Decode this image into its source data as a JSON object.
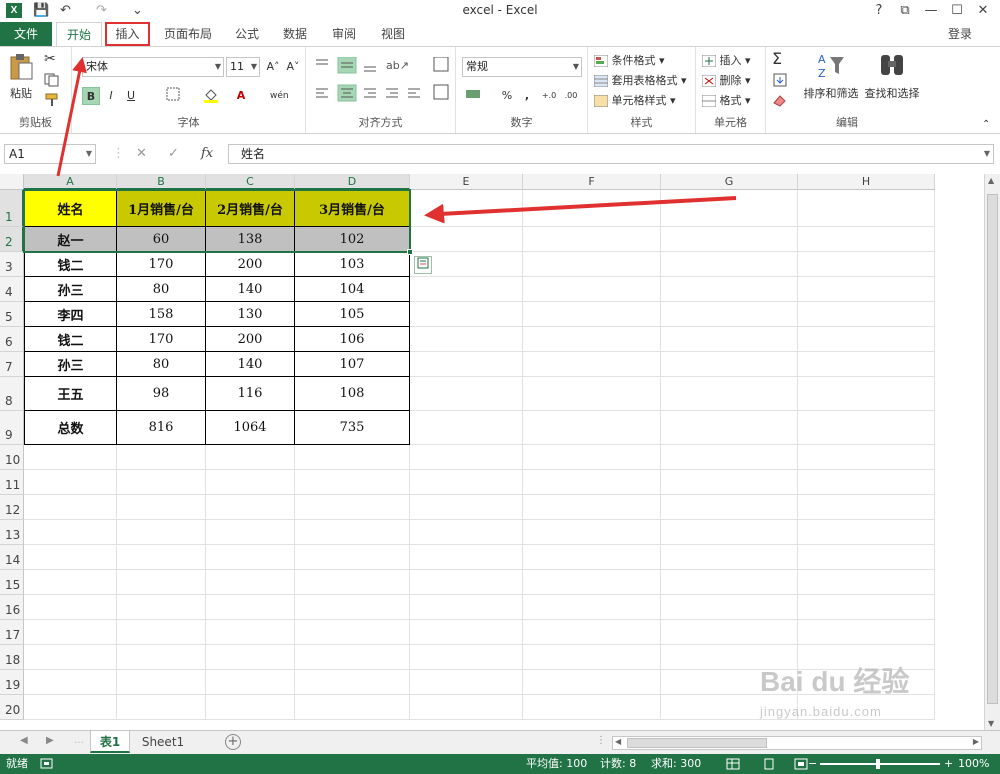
{
  "window": {
    "title": "excel - Excel",
    "help": "?",
    "restore": "⧉",
    "minimize": "—",
    "maximize": "☐",
    "close": "✕",
    "app_icon_label": "X"
  },
  "qat": {
    "save": "💾",
    "undo": "↶",
    "redo": "↷",
    "customize": "⌄"
  },
  "tabs": {
    "file": "文件",
    "items": [
      "开始",
      "插入",
      "页面布局",
      "公式",
      "数据",
      "审阅",
      "视图"
    ],
    "login": "登录"
  },
  "ribbon": {
    "clipboard": {
      "label": "剪贴板",
      "paste": "粘贴"
    },
    "font": {
      "label": "字体",
      "name": "宋体",
      "size": "11",
      "bold": "B",
      "italic": "I",
      "underline": "U",
      "grow": "A˄",
      "shrink": "A˅",
      "wen": "wén"
    },
    "alignment": {
      "label": "对齐方式"
    },
    "number": {
      "label": "数字",
      "format": "常规",
      "percent": "%",
      "comma": ",",
      "inc": "+.0",
      "dec": ".00"
    },
    "styles": {
      "label": "样式",
      "cond": "条件格式",
      "table": "套用表格格式",
      "cell": "单元格样式"
    },
    "cells": {
      "label": "单元格",
      "insert": "插入",
      "delete": "删除",
      "format": "格式"
    },
    "editing": {
      "label": "编辑",
      "sort": "排序和筛选",
      "find": "查找和选择",
      "sum": "Σ"
    }
  },
  "formula_bar": {
    "name_box": "A1",
    "cancel": "✕",
    "enter": "✓",
    "fx": "fx",
    "value": "姓名"
  },
  "columns": [
    "A",
    "B",
    "C",
    "D",
    "E",
    "F",
    "G",
    "H"
  ],
  "rows": [
    "1",
    "2",
    "3",
    "4",
    "5",
    "6",
    "7",
    "8",
    "9",
    "10",
    "11",
    "12",
    "13",
    "14",
    "15",
    "16",
    "17",
    "18",
    "19",
    "20"
  ],
  "table": {
    "header": [
      "姓名",
      "1月销售/台",
      "2月销售/台",
      "3月销售/台"
    ],
    "rows": [
      [
        "赵一",
        "60",
        "138",
        "102"
      ],
      [
        "钱二",
        "170",
        "200",
        "103"
      ],
      [
        "孙三",
        "80",
        "140",
        "104"
      ],
      [
        "李四",
        "158",
        "130",
        "105"
      ],
      [
        "钱二",
        "170",
        "200",
        "106"
      ],
      [
        "孙三",
        "80",
        "140",
        "107"
      ],
      [
        "王五",
        "98",
        "116",
        "108"
      ],
      [
        "总数",
        "816",
        "1064",
        "735"
      ]
    ]
  },
  "sheets": {
    "tabs": [
      "表1",
      "Sheet1"
    ],
    "add": "+"
  },
  "status": {
    "ready": "就绪",
    "average": "平均值: 100",
    "count": "计数: 8",
    "sum": "求和: 300",
    "zoom": "100%"
  },
  "colors": {
    "excel_green": "#217346",
    "header_yellow": "#ffff00",
    "header_olive": "#c9c900",
    "row_gray": "#c0c0c0",
    "annotation_red": "#e03030"
  },
  "watermark": {
    "text": "Bai du 经验",
    "sub": "jingyan.baidu.com"
  }
}
